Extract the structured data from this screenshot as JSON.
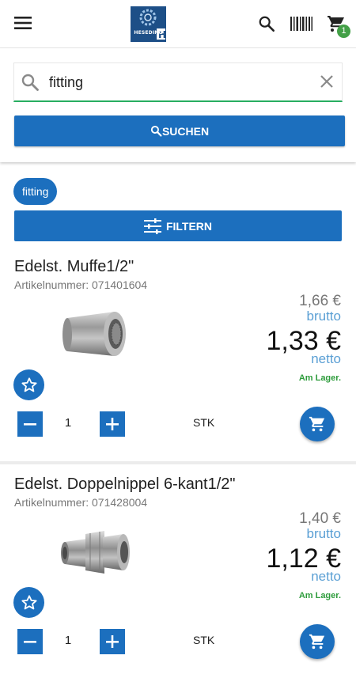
{
  "header": {
    "logo_text": "HESEDING",
    "cart_count": "1",
    "menu_icon": "menu-icon",
    "search_icon": "search-icon",
    "barcode_icon": "barcode-icon",
    "cart_icon": "cart-icon"
  },
  "search": {
    "value": "fitting",
    "button_label": "SUCHEN"
  },
  "filters": {
    "chip_label": "fitting",
    "button_label": "FILTERN"
  },
  "products": [
    {
      "name": "Edelst. Muffe1/2\"",
      "article": "Artikelnummer: 071401604",
      "brutto_price": "1,66 €",
      "brutto_label": "brutto",
      "netto_price": "1,33 €",
      "netto_label": "netto",
      "stock": "Am Lager.",
      "quantity": "1",
      "unit": "STK"
    },
    {
      "name": "Edelst. Doppelnippel 6-kant1/2\"",
      "article": "Artikelnummer: 071428004",
      "brutto_price": "1,40 €",
      "brutto_label": "brutto",
      "netto_price": "1,12 €",
      "netto_label": "netto",
      "stock": "Am Lager.",
      "quantity": "1",
      "unit": "STK"
    }
  ],
  "colors": {
    "primary": "#1c6fbe",
    "accent_green": "#27ae60",
    "price_label": "#5a9fd4",
    "badge": "#43a047"
  }
}
